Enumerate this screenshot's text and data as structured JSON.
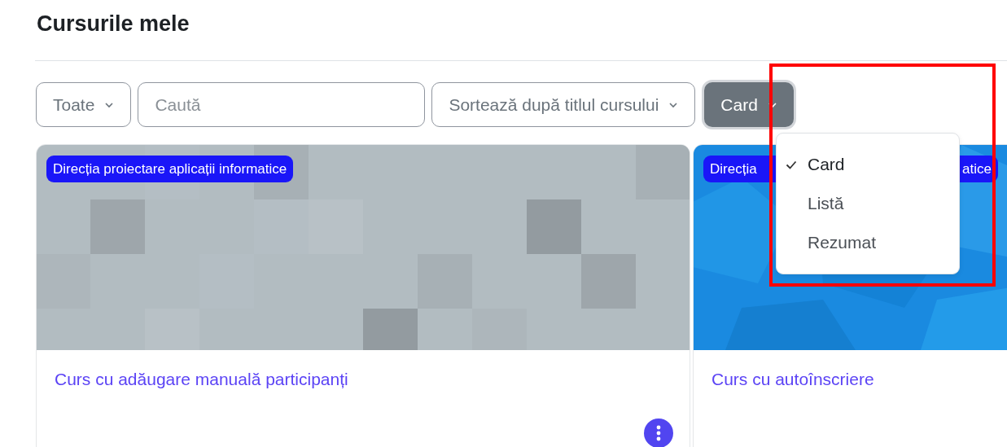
{
  "page": {
    "title": "Cursurile mele"
  },
  "filters": {
    "grouping": {
      "label": "Toate"
    },
    "search": {
      "placeholder": "Caută"
    },
    "sort": {
      "label": "Sortează după titlul cursului"
    },
    "view": {
      "label": "Card",
      "expanded": true
    }
  },
  "view_menu": [
    {
      "label": "Card",
      "selected": true
    },
    {
      "label": "Listă",
      "selected": false
    },
    {
      "label": "Rezumat",
      "selected": false
    }
  ],
  "courses": [
    {
      "category": "Direcția proiectare aplicații informatice",
      "title": "Curs cu adăugare manuală participanți"
    },
    {
      "category": "Direcția",
      "category_end": "atice",
      "title": "Curs cu autoînscriere"
    }
  ]
}
